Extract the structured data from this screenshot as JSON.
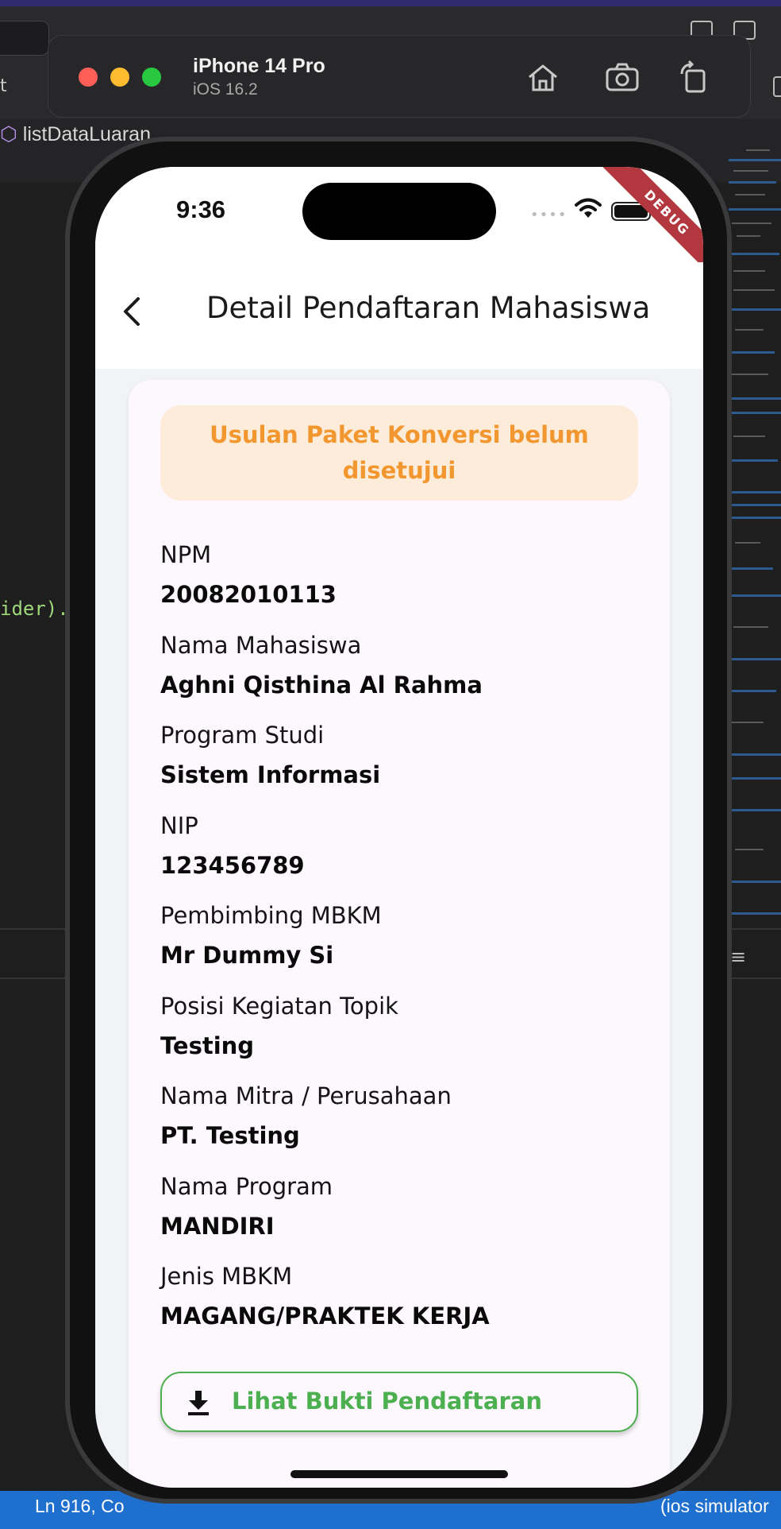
{
  "editor": {
    "left_fragment": "t",
    "breadcrumb": "listDataLuaran",
    "code_fragment": "ider).",
    "status_left": "Ln 916, Co",
    "status_right": "(ios simulator"
  },
  "simulator": {
    "device_name": "iPhone 14 Pro",
    "os_version": "iOS 16.2",
    "traffic_colors": [
      "#ff5f57",
      "#febc2e",
      "#28c840"
    ]
  },
  "status_bar": {
    "time": "9:36",
    "debug_label": "DEBUG"
  },
  "app_bar": {
    "title": "Detail Pendaftaran Mahasiswa",
    "back_icon": "chevron-left-icon"
  },
  "banner": {
    "text": "Usulan Paket Konversi belum disetujui",
    "background": "#fdecd9",
    "color": "#f29730"
  },
  "fields": [
    {
      "label": "NPM",
      "value": "20082010113"
    },
    {
      "label": "Nama Mahasiswa",
      "value": "Aghni Qisthina Al Rahma"
    },
    {
      "label": "Program Studi",
      "value": "Sistem Informasi"
    },
    {
      "label": "NIP",
      "value": "123456789"
    },
    {
      "label": "Pembimbing MBKM",
      "value": "Mr Dummy Si"
    },
    {
      "label": "Posisi Kegiatan Topik",
      "value": "Testing"
    },
    {
      "label": "Nama Mitra / Perusahaan",
      "value": "PT. Testing"
    },
    {
      "label": "Nama Program",
      "value": "MANDIRI"
    },
    {
      "label": "Jenis MBKM",
      "value": "MAGANG/PRAKTEK KERJA"
    }
  ],
  "download_button": {
    "label": "Lihat Bukti Pendaftaran",
    "icon": "download-icon",
    "color": "#4caf50"
  }
}
